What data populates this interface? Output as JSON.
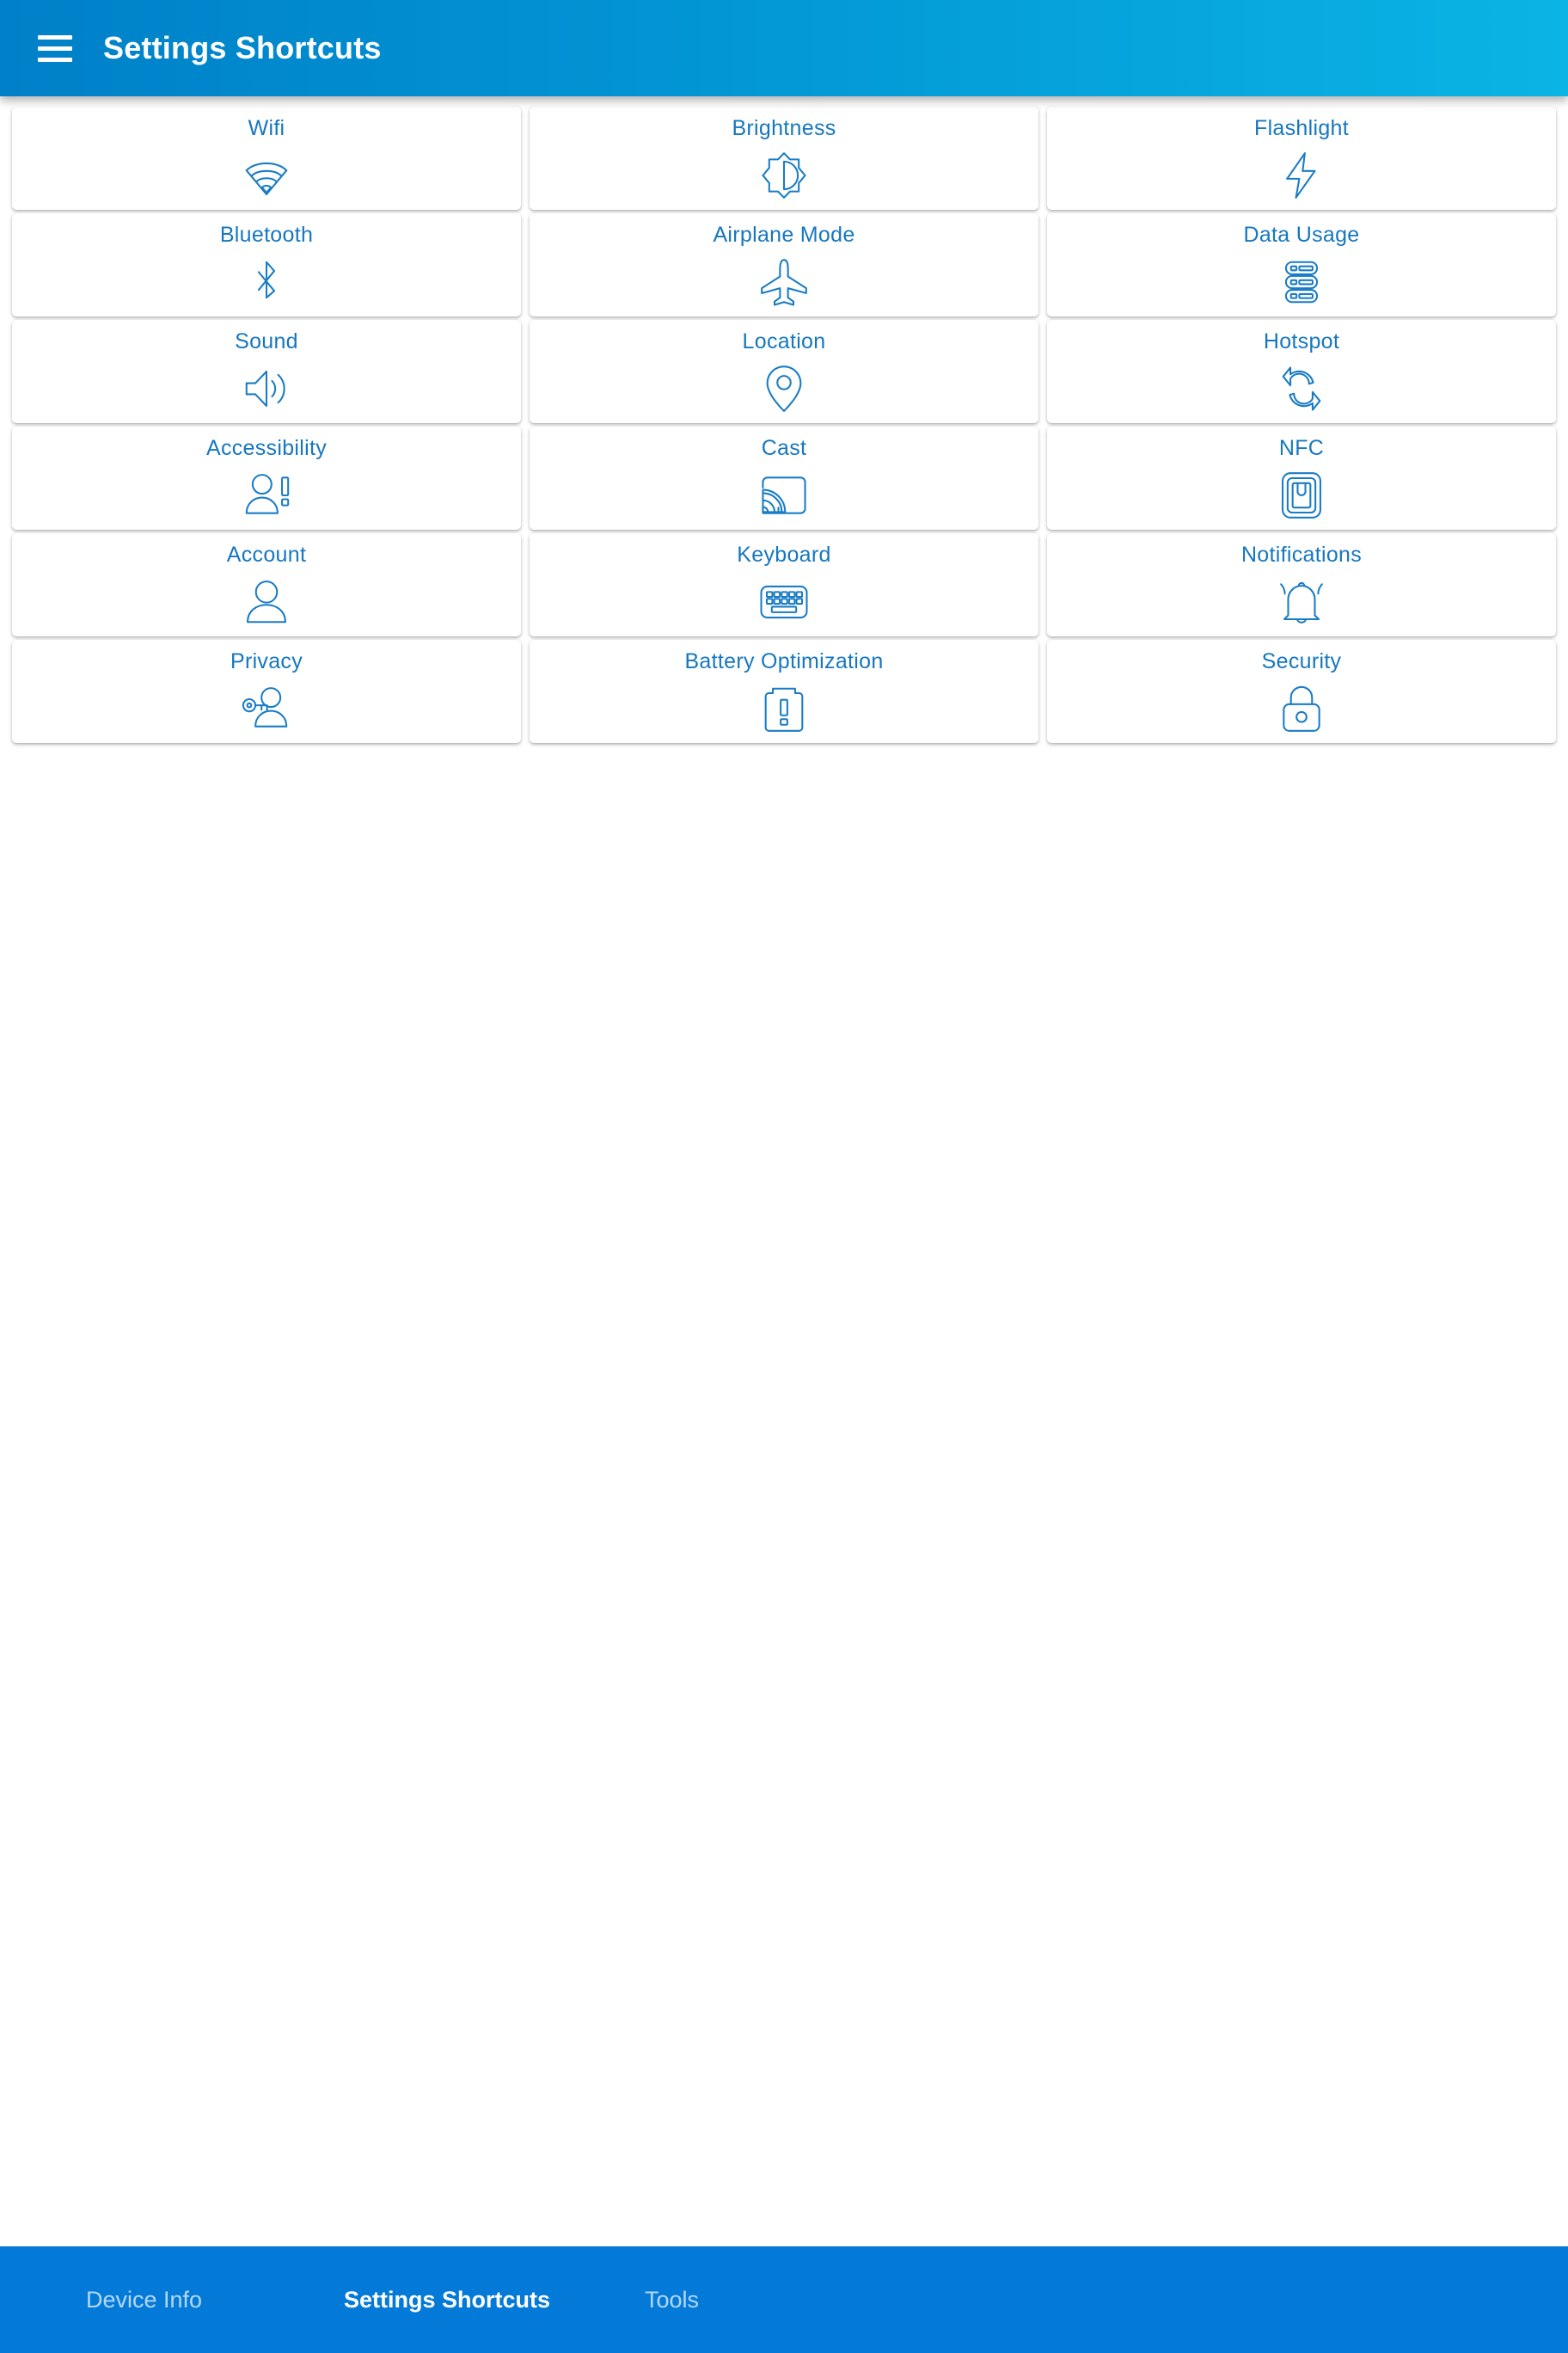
{
  "appbar": {
    "menu_icon": "hamburger-menu-icon",
    "title": "Settings Shortcuts"
  },
  "colors": {
    "appbar_gradient_start": "#0080c8",
    "appbar_gradient_end": "#0ab4e4",
    "card_text": "#1677bf",
    "icon_stroke": "#1a7cc4",
    "bottom_nav_bg": "#047ad8",
    "card_bg": "#ffffff",
    "page_bg": "#ffffff"
  },
  "shortcuts": [
    {
      "label": "Wifi",
      "icon": "wifi-icon"
    },
    {
      "label": "Brightness",
      "icon": "brightness-icon"
    },
    {
      "label": "Flashlight",
      "icon": "flashlight-icon"
    },
    {
      "label": "Bluetooth",
      "icon": "bluetooth-icon"
    },
    {
      "label": "Airplane Mode",
      "icon": "airplane-icon"
    },
    {
      "label": "Data Usage",
      "icon": "data-usage-icon"
    },
    {
      "label": "Sound",
      "icon": "sound-icon"
    },
    {
      "label": "Location",
      "icon": "location-pin-icon"
    },
    {
      "label": "Hotspot",
      "icon": "sync-arrows-icon"
    },
    {
      "label": "Accessibility",
      "icon": "accessibility-person-icon"
    },
    {
      "label": "Cast",
      "icon": "cast-screen-icon"
    },
    {
      "label": "NFC",
      "icon": "nfc-icon"
    },
    {
      "label": "Account",
      "icon": "account-person-icon"
    },
    {
      "label": "Keyboard",
      "icon": "keyboard-icon"
    },
    {
      "label": "Notifications",
      "icon": "bell-icon"
    },
    {
      "label": "Privacy",
      "icon": "key-person-icon"
    },
    {
      "label": "Battery Optimization",
      "icon": "battery-alert-icon"
    },
    {
      "label": "Security",
      "icon": "lock-icon"
    }
  ],
  "bottom_nav": {
    "items": [
      {
        "label": "Device Info",
        "active": false
      },
      {
        "label": "Settings Shortcuts",
        "active": true
      },
      {
        "label": "Tools",
        "active": false
      }
    ]
  }
}
